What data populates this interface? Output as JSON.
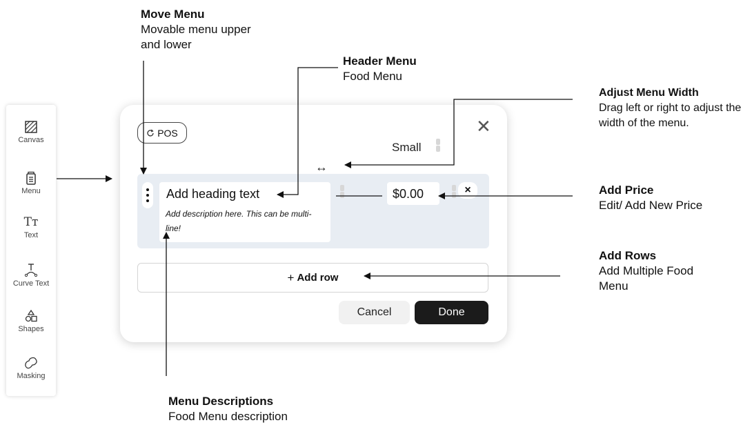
{
  "sidebar": {
    "items": [
      {
        "label": "Canvas",
        "icon": "canvas-icon"
      },
      {
        "label": "Menu",
        "icon": "menu-icon"
      },
      {
        "label": "Text",
        "icon": "text-icon",
        "glyph": "Tт"
      },
      {
        "label": "Curve Text",
        "icon": "curve-text-icon"
      },
      {
        "label": "Shapes",
        "icon": "shapes-icon"
      },
      {
        "label": "Masking",
        "icon": "masking-icon"
      }
    ]
  },
  "dialog": {
    "pos_label": "POS",
    "size_value": "Small",
    "width_arrow": "↔",
    "row": {
      "heading": "Add heading text",
      "description": "Add description here. This can be multi-line!",
      "price": "$0.00",
      "remove": "×"
    },
    "add_row_plus": "+",
    "add_row_label": "Add row",
    "cancel_label": "Cancel",
    "done_label": "Done",
    "close_glyph": "✕"
  },
  "annotations": {
    "move_menu": {
      "title": "Move Menu",
      "desc": "Movable menu upper and lower"
    },
    "header_menu": {
      "title": "Header Menu",
      "desc": "Food Menu"
    },
    "adjust_width": {
      "title": "Adjust Menu Width",
      "desc": "Drag left or right to adjust the width of the menu."
    },
    "add_price": {
      "title": "Add Price",
      "desc": "Edit/ Add New Price"
    },
    "add_rows": {
      "title": "Add Rows",
      "desc": "Add Multiple Food Menu"
    },
    "menu_descriptions": {
      "title": "Menu Descriptions",
      "desc": "Food Menu description"
    }
  },
  "colors": {
    "panel": "#e8edf3",
    "done": "#1b1b1b",
    "cancel": "#f1f1f1"
  }
}
